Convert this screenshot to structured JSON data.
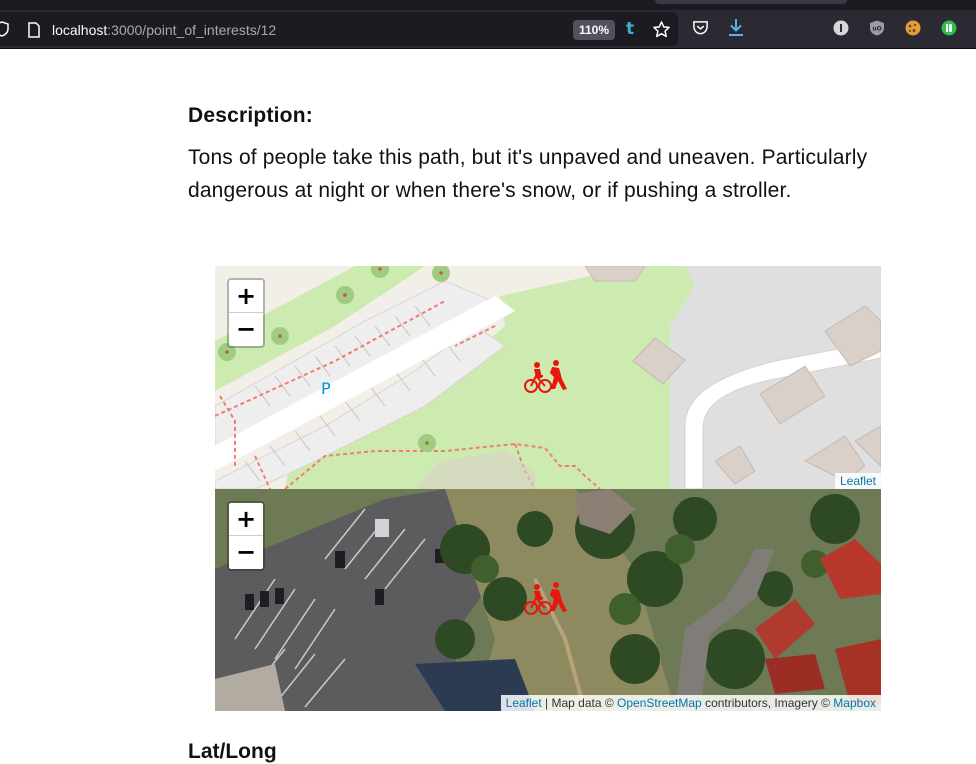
{
  "browser": {
    "url_host": "localhost",
    "url_path": ":3000/point_of_interests/12",
    "zoom_level": "110%",
    "tumblr_label": "t"
  },
  "content": {
    "description_heading": "Description:",
    "description_text": "Tons of people take this path, but it's unpaved and uneaven. Particularly dangerous at night or when there's snow, or if pushing a stroller.",
    "next_heading": "Lat/Long"
  },
  "map_street": {
    "zoom_in": "+",
    "zoom_out": "−",
    "parking_label": "P",
    "attribution_leaflet": "Leaflet",
    "marker_icon": "bicycle-pedestrian-icon",
    "marker_color": "#e8170e"
  },
  "map_satellite": {
    "zoom_in": "+",
    "zoom_out": "−",
    "attribution_leaflet": "Leaflet",
    "attribution_sep1": " | Map data © ",
    "attribution_osm": "OpenStreetMap",
    "attribution_sep2": " contributors, Imagery © ",
    "attribution_mapbox": "Mapbox",
    "marker_icon": "bicycle-pedestrian-icon",
    "marker_color": "#e8170e"
  }
}
